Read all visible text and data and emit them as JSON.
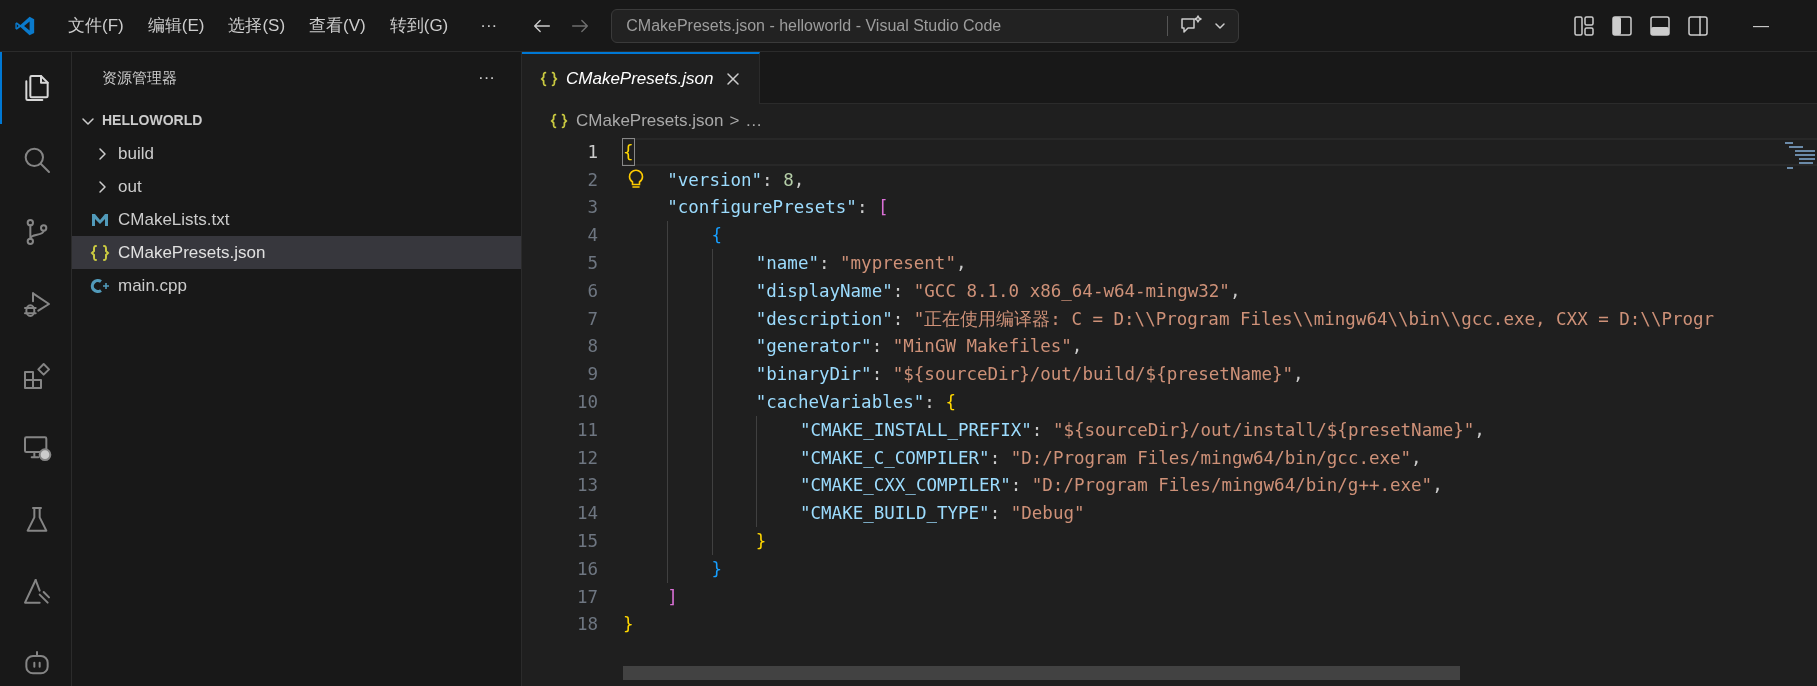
{
  "title_bar": {
    "menus": [
      "文件(F)",
      "编辑(E)",
      "选择(S)",
      "查看(V)",
      "转到(G)"
    ],
    "more": "···",
    "command_center": "CMakePresets.json - helloworld - Visual Studio Code",
    "minimize": "—"
  },
  "activity_bar": {
    "items": [
      {
        "kind": "files",
        "selected": true
      },
      {
        "kind": "search",
        "selected": false
      },
      {
        "kind": "source-control",
        "selected": false
      },
      {
        "kind": "run-debug",
        "selected": false
      },
      {
        "kind": "extensions",
        "selected": false
      },
      {
        "kind": "remote",
        "selected": false
      },
      {
        "kind": "testing",
        "selected": false
      },
      {
        "kind": "cmake",
        "selected": false
      },
      {
        "kind": "robot",
        "selected": false
      }
    ]
  },
  "sidebar": {
    "title": "资源管理器",
    "more": "···",
    "root": {
      "label": "HELLOWORLD",
      "expanded": true,
      "children": [
        {
          "label": "build",
          "kind": "folder",
          "expanded": false,
          "selected": false
        },
        {
          "label": "out",
          "kind": "folder",
          "expanded": false,
          "selected": false
        },
        {
          "label": "CMakeLists.txt",
          "kind": "cmake",
          "selected": false
        },
        {
          "label": "CMakePresets.json",
          "kind": "json",
          "selected": true
        },
        {
          "label": "main.cpp",
          "kind": "cpp",
          "selected": false
        }
      ]
    }
  },
  "tabs": [
    {
      "label": "CMakePresets.json",
      "kind": "json",
      "selected": true,
      "preview": true
    }
  ],
  "breadcrumb": {
    "file": "CMakePresets.json",
    "separator": ">",
    "rest": "…"
  },
  "editor": {
    "lines": [
      {
        "number": "1",
        "current": true,
        "lightbulb": false,
        "tokens": [
          {
            "kind": "bracket",
            "text": "{",
            "color": "#ffd700"
          }
        ]
      },
      {
        "number": "2",
        "current": false,
        "lightbulb": true,
        "tokens": [
          {
            "kind": "key",
            "text": "\"version\""
          },
          {
            "kind": "punct",
            "text": ": "
          },
          {
            "kind": "number",
            "text": "8"
          },
          {
            "kind": "punct",
            "text": ","
          }
        ]
      },
      {
        "number": "3",
        "current": false,
        "lightbulb": false,
        "tokens": [
          {
            "kind": "key",
            "text": "\"configurePresets\""
          },
          {
            "kind": "punct",
            "text": ": "
          },
          {
            "kind": "bracket",
            "text": "[",
            "color": "#da70d6"
          }
        ]
      },
      {
        "number": "4",
        "current": false,
        "lightbulb": false,
        "tokens": [
          {
            "kind": "bracket",
            "text": "{",
            "color": "#179fff"
          }
        ]
      },
      {
        "number": "5",
        "current": false,
        "lightbulb": false,
        "tokens": [
          {
            "kind": "key",
            "text": "\"name\""
          },
          {
            "kind": "punct",
            "text": ": "
          },
          {
            "kind": "string",
            "text": "\"mypresent\""
          },
          {
            "kind": "punct",
            "text": ","
          }
        ]
      },
      {
        "number": "6",
        "current": false,
        "lightbulb": false,
        "tokens": [
          {
            "kind": "key",
            "text": "\"displayName\""
          },
          {
            "kind": "punct",
            "text": ": "
          },
          {
            "kind": "string",
            "text": "\"GCC 8.1.0 x86_64-w64-mingw32\""
          },
          {
            "kind": "punct",
            "text": ","
          }
        ]
      },
      {
        "number": "7",
        "current": false,
        "lightbulb": false,
        "tokens": [
          {
            "kind": "key",
            "text": "\"description\""
          },
          {
            "kind": "punct",
            "text": ": "
          },
          {
            "kind": "string",
            "text": "\"正在使用编译器: C = D:\\\\Program Files\\\\mingw64\\\\bin\\\\gcc.exe, CXX = D:\\\\Progr"
          }
        ]
      },
      {
        "number": "8",
        "current": false,
        "lightbulb": false,
        "tokens": [
          {
            "kind": "key",
            "text": "\"generator\""
          },
          {
            "kind": "punct",
            "text": ": "
          },
          {
            "kind": "string",
            "text": "\"MinGW Makefiles\""
          },
          {
            "kind": "punct",
            "text": ","
          }
        ]
      },
      {
        "number": "9",
        "current": false,
        "lightbulb": false,
        "tokens": [
          {
            "kind": "key",
            "text": "\"binaryDir\""
          },
          {
            "kind": "punct",
            "text": ": "
          },
          {
            "kind": "string",
            "text": "\"${sourceDir}/out/build/${presetName}\""
          },
          {
            "kind": "punct",
            "text": ","
          }
        ]
      },
      {
        "number": "10",
        "current": false,
        "lightbulb": false,
        "tokens": [
          {
            "kind": "key",
            "text": "\"cacheVariables\""
          },
          {
            "kind": "punct",
            "text": ": "
          },
          {
            "kind": "bracket",
            "text": "{",
            "color": "#ffd700"
          }
        ]
      },
      {
        "number": "11",
        "current": false,
        "lightbulb": false,
        "tokens": [
          {
            "kind": "key",
            "text": "\"CMAKE_INSTALL_PREFIX\""
          },
          {
            "kind": "punct",
            "text": ": "
          },
          {
            "kind": "string",
            "text": "\"${sourceDir}/out/install/${presetName}\""
          },
          {
            "kind": "punct",
            "text": ","
          }
        ]
      },
      {
        "number": "12",
        "current": false,
        "lightbulb": false,
        "tokens": [
          {
            "kind": "key",
            "text": "\"CMAKE_C_COMPILER\""
          },
          {
            "kind": "punct",
            "text": ": "
          },
          {
            "kind": "string",
            "text": "\"D:/Program Files/mingw64/bin/gcc.exe\""
          },
          {
            "kind": "punct",
            "text": ","
          }
        ]
      },
      {
        "number": "13",
        "current": false,
        "lightbulb": false,
        "tokens": [
          {
            "kind": "key",
            "text": "\"CMAKE_CXX_COMPILER\""
          },
          {
            "kind": "punct",
            "text": ": "
          },
          {
            "kind": "string",
            "text": "\"D:/Program Files/mingw64/bin/g++.exe\""
          },
          {
            "kind": "punct",
            "text": ","
          }
        ]
      },
      {
        "number": "14",
        "current": false,
        "lightbulb": false,
        "tokens": [
          {
            "kind": "key",
            "text": "\"CMAKE_BUILD_TYPE\""
          },
          {
            "kind": "punct",
            "text": ": "
          },
          {
            "kind": "string",
            "text": "\"Debug\""
          }
        ]
      },
      {
        "number": "15",
        "current": false,
        "lightbulb": false,
        "tokens": [
          {
            "kind": "bracket",
            "text": "}",
            "color": "#ffd700"
          }
        ]
      },
      {
        "number": "16",
        "current": false,
        "lightbulb": false,
        "tokens": [
          {
            "kind": "bracket",
            "text": "}",
            "color": "#179fff"
          }
        ]
      },
      {
        "number": "17",
        "current": false,
        "lightbulb": false,
        "tokens": [
          {
            "kind": "bracket",
            "text": "]",
            "color": "#da70d6"
          }
        ]
      },
      {
        "number": "18",
        "current": false,
        "lightbulb": false,
        "tokens": [
          {
            "kind": "bracket",
            "text": "}",
            "color": "#ffd700"
          }
        ]
      }
    ]
  }
}
